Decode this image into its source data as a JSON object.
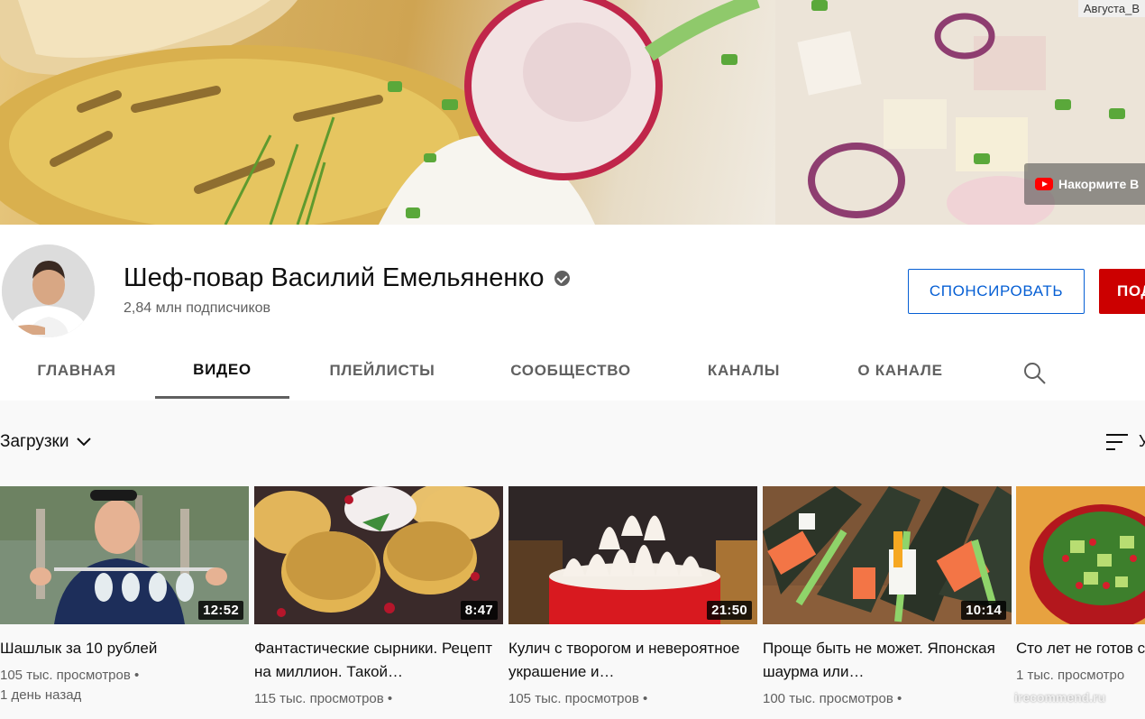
{
  "banner": {
    "user_label": "Августа_В",
    "link_text": "Накормите В"
  },
  "channel": {
    "name": "Шеф-повар Василий Емельяненко",
    "subscribers": "2,84 млн подписчиков",
    "sponsor_label": "СПОНСИРОВАТЬ",
    "subscribe_label": "ПОД",
    "verified": true
  },
  "tabs": [
    {
      "label": "ГЛАВНАЯ",
      "active": false
    },
    {
      "label": "ВИДЕО",
      "active": true
    },
    {
      "label": "ПЛЕЙЛИСТЫ",
      "active": false
    },
    {
      "label": "СООБЩЕСТВО",
      "active": false
    },
    {
      "label": "КАНАЛЫ",
      "active": false
    },
    {
      "label": "О КАНАЛЕ",
      "active": false
    }
  ],
  "filter": {
    "uploads_label": "Загрузки",
    "sort_label": "У"
  },
  "videos": [
    {
      "title": "Шашлык за 10 рублей",
      "views": "105 тыс. просмотров",
      "age": "1 день назад",
      "duration": "12:52"
    },
    {
      "title": "Фантастические сырники. Рецепт на миллион. Такой…",
      "views": "115 тыс. просмотров",
      "age": "",
      "duration": "8:47"
    },
    {
      "title": "Кулич с творогом и невероятное украшение и…",
      "views": "105 тыс. просмотров",
      "age": "",
      "duration": "21:50"
    },
    {
      "title": "Проще быть не может. Японская шаурма или…",
      "views": "100 тыс. просмотров",
      "age": "",
      "duration": "10:14"
    },
    {
      "title": "Сто лет не готов салат, а зря. Пос",
      "views": "1 тыс. просмотро",
      "age": "",
      "duration": ""
    }
  ],
  "watermark": "irecommend.ru",
  "colors": {
    "subscribe_red": "#cc0000",
    "sponsor_blue": "#065fd4",
    "text_secondary": "#606060"
  }
}
